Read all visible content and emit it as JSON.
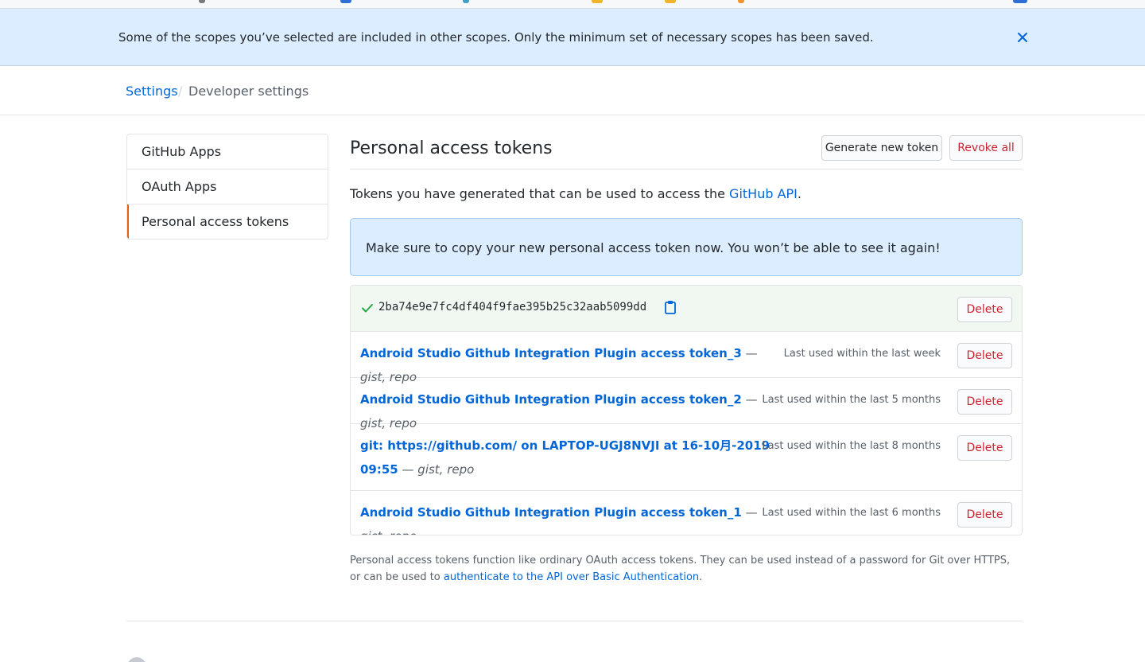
{
  "flash": {
    "message": "Some of the scopes you’ve selected are included in other scopes. Only the minimum set of necessary scopes has been saved.",
    "close_icon": "x-icon"
  },
  "breadcrumb": {
    "parent": "Settings",
    "separator": "/",
    "current": "Developer settings"
  },
  "sidebar": {
    "items": [
      {
        "label": "GitHub Apps"
      },
      {
        "label": "OAuth Apps"
      },
      {
        "label": "Personal access tokens"
      }
    ]
  },
  "main": {
    "title": "Personal access tokens",
    "generate_label": "Generate new token",
    "revoke_label": "Revoke all",
    "intro_prefix": "Tokens you have generated that can be used to access the ",
    "intro_link": "GitHub API",
    "intro_suffix": ".",
    "notice": "Make sure to copy your new personal access token now. You won’t be able to see it again!",
    "new_token": {
      "value": "2ba74e9e7fc4df404f9fae395b25c32aab5099dd",
      "delete_label": "Delete"
    },
    "tokens": [
      {
        "name": "Android Studio Github Integration Plugin access token_3",
        "dash": " — ",
        "scopes": "gist, repo",
        "last_used": "Last used within the last week",
        "delete_label": "Delete"
      },
      {
        "name": "Android Studio Github Integration Plugin access token_2",
        "dash": " — ",
        "scopes": "gist, repo",
        "last_used": "Last used within the last 5 months",
        "delete_label": "Delete"
      },
      {
        "name": "git: https://github.com/ on LAPTOP-UGJ8NVJI at 16-10月-2019 09:55",
        "dash": " — ",
        "scopes": "gist, repo",
        "last_used": "Last used within the last 8 months",
        "delete_label": "Delete"
      },
      {
        "name": "Android Studio Github Integration Plugin access token_1",
        "dash": " — ",
        "scopes": "gist, repo",
        "last_used": "Last used within the last 6 months",
        "delete_label": "Delete"
      }
    ],
    "note_prefix": "Personal access tokens function like ordinary OAuth access tokens. They can be used instead of a password for Git over HTTPS, or can be used to ",
    "note_link": "authenticate to the API over Basic Authentication",
    "note_suffix": "."
  },
  "colors": {
    "link": "#0366d6",
    "danger": "#cb2431",
    "flash_bg": "#dbedff",
    "success_bg": "#f0f8f1",
    "selected_accent": "#e36209"
  }
}
